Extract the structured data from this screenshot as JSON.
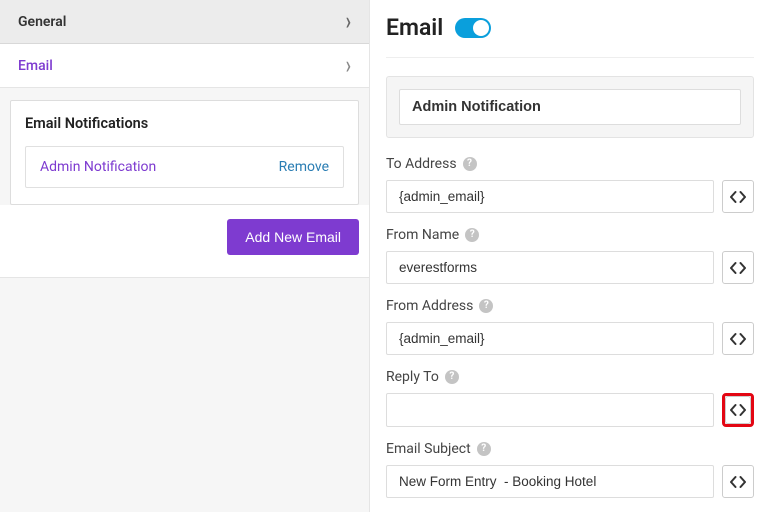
{
  "sidebar": {
    "tab_general": "General",
    "tab_email": "Email",
    "notif_title": "Email Notifications",
    "notif_item_name": "Admin Notification",
    "notif_item_remove": "Remove",
    "add_button": "Add New Email"
  },
  "main": {
    "title": "Email",
    "toggle_on": true,
    "section_name": "Admin Notification",
    "fields": {
      "to_address": {
        "label": "To Address",
        "value": "{admin_email}"
      },
      "from_name": {
        "label": "From Name",
        "value": "everestforms"
      },
      "from_address": {
        "label": "From Address",
        "value": "{admin_email}"
      },
      "reply_to": {
        "label": "Reply To",
        "value": ""
      },
      "email_subject": {
        "label": "Email Subject",
        "value": "New Form Entry  - Booking Hotel"
      }
    }
  }
}
